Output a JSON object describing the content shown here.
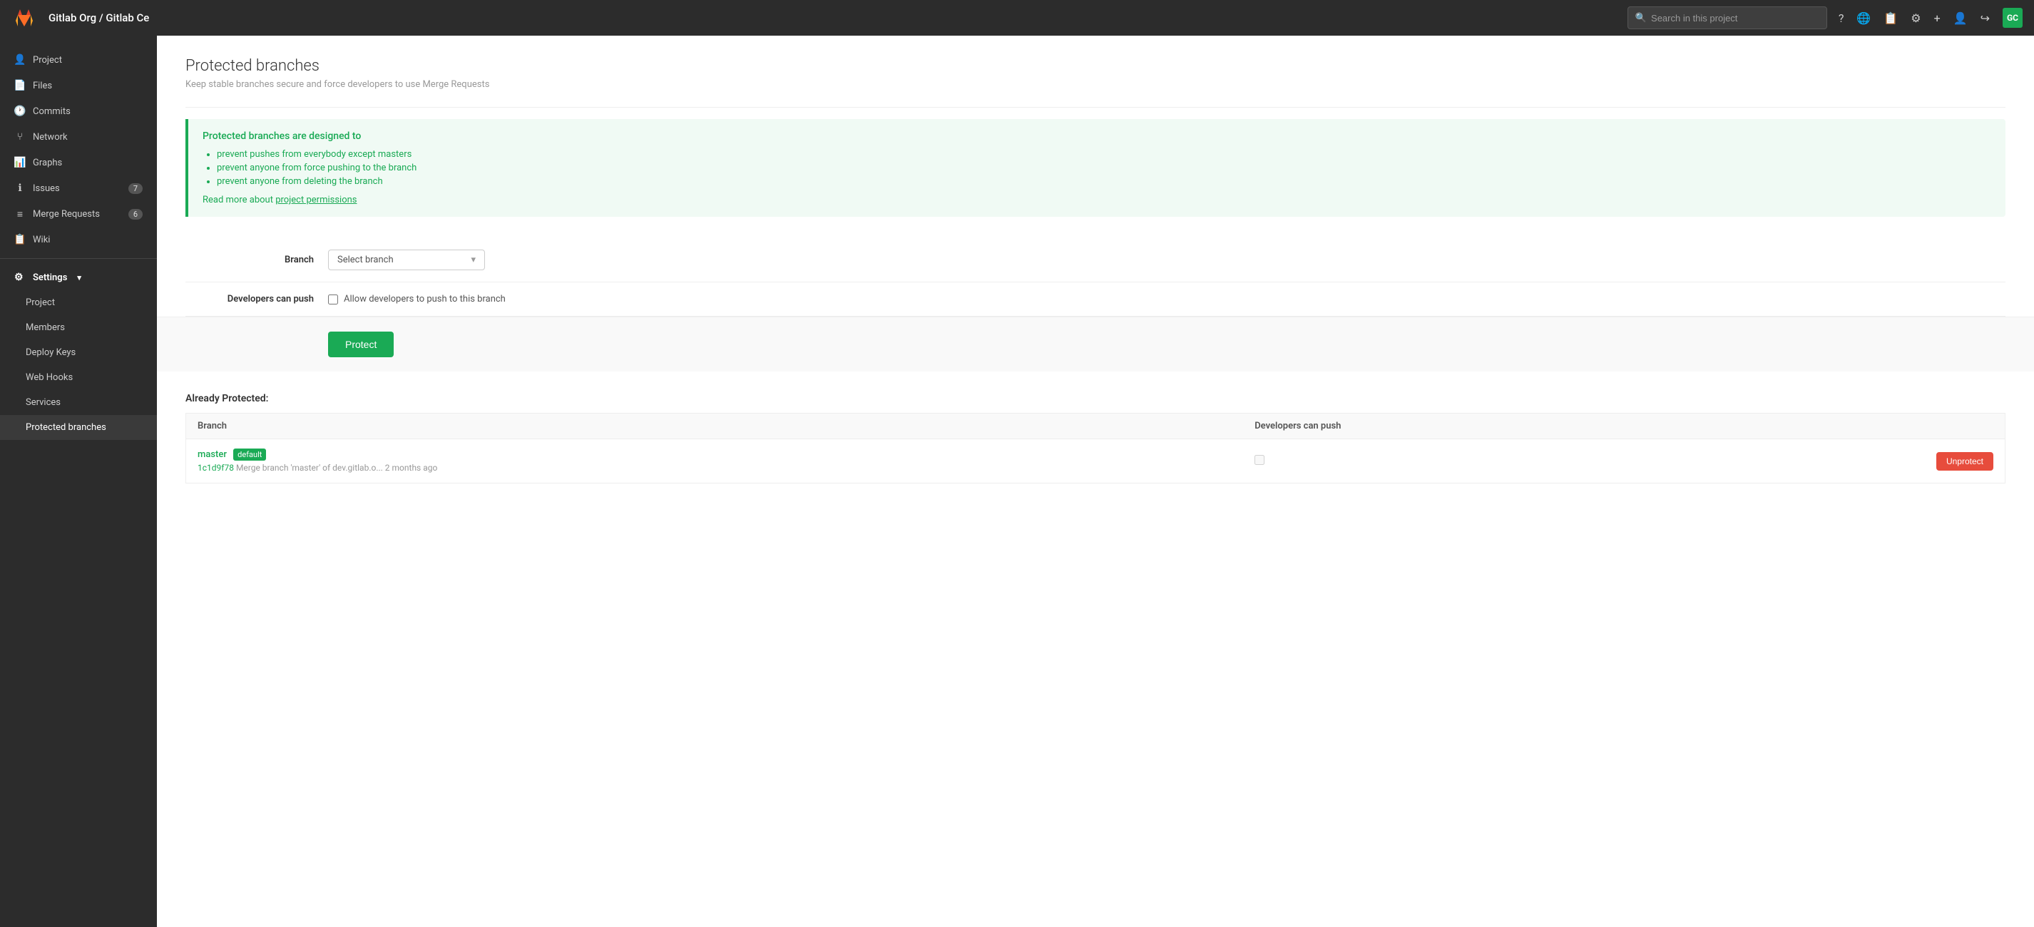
{
  "topnav": {
    "logo_alt": "GitLab",
    "title": "Gitlab Org / Gitlab Ce",
    "search_placeholder": "Search in this project",
    "avatar_initials": "GC"
  },
  "sidebar": {
    "nav_items": [
      {
        "id": "project",
        "label": "Project",
        "icon": "👤",
        "badge": null
      },
      {
        "id": "files",
        "label": "Files",
        "icon": "📄",
        "badge": null
      },
      {
        "id": "commits",
        "label": "Commits",
        "icon": "🕐",
        "badge": null
      },
      {
        "id": "network",
        "label": "Network",
        "icon": "⑂",
        "badge": null
      },
      {
        "id": "graphs",
        "label": "Graphs",
        "icon": "📊",
        "badge": null
      },
      {
        "id": "issues",
        "label": "Issues",
        "icon": "ℹ",
        "badge": "7"
      },
      {
        "id": "merge-requests",
        "label": "Merge Requests",
        "icon": "≡",
        "badge": "6"
      },
      {
        "id": "wiki",
        "label": "Wiki",
        "icon": "📋",
        "badge": null
      }
    ],
    "settings_label": "Settings",
    "settings_items": [
      {
        "id": "project-settings",
        "label": "Project",
        "icon": "✎"
      },
      {
        "id": "members",
        "label": "Members",
        "icon": "👥"
      },
      {
        "id": "deploy-keys",
        "label": "Deploy Keys",
        "icon": "🔑"
      },
      {
        "id": "web-hooks",
        "label": "Web Hooks",
        "icon": "🔗"
      },
      {
        "id": "services",
        "label": "Services",
        "icon": "⚙"
      },
      {
        "id": "protected-branches",
        "label": "Protected branches",
        "icon": "🔒",
        "active": true
      }
    ]
  },
  "main": {
    "page_title": "Protected branches",
    "page_subtitle": "Keep stable branches secure and force developers to use Merge Requests",
    "info_box": {
      "title": "Protected branches are designed to",
      "items": [
        "prevent pushes from everybody except masters",
        "prevent anyone from force pushing to the branch",
        "prevent anyone from deleting the branch"
      ],
      "read_more_text": "Read more about ",
      "link_text": "project permissions"
    },
    "form": {
      "branch_label": "Branch",
      "branch_select_placeholder": "Select branch",
      "developers_push_label": "Developers can push",
      "allow_push_label": "Allow developers to push to this branch"
    },
    "protect_button": "Protect",
    "already_protected": {
      "title": "Already Protected:",
      "columns": [
        "Branch",
        "Developers can push"
      ],
      "rows": [
        {
          "branch_name": "master",
          "default_badge": "default",
          "commit_hash": "1c1d9f78",
          "commit_message": "Merge branch 'master' of dev.gitlab.o...",
          "commit_time": "2 months ago",
          "devs_can_push": false,
          "unprotect_label": "Unprotect"
        }
      ]
    }
  }
}
